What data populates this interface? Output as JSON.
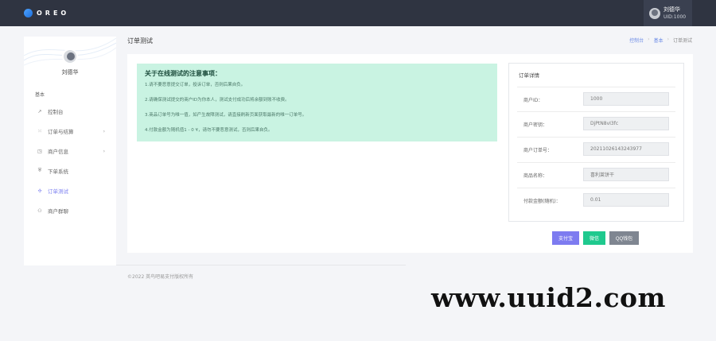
{
  "brand": {
    "logo_text": "OREO"
  },
  "user": {
    "name": "刘德华",
    "uid": "UID:1000"
  },
  "sidebar": {
    "username": "刘德华",
    "section": "基本",
    "items": [
      {
        "label": "控制台",
        "icon": "dashboard-icon"
      },
      {
        "label": "订单与结算",
        "icon": "grid-icon",
        "has_arrow": true
      },
      {
        "label": "商户信息",
        "icon": "store-icon",
        "has_arrow": true
      },
      {
        "label": "下单系统",
        "icon": "shield-icon"
      },
      {
        "label": "订单测试",
        "icon": "test-icon",
        "active": true
      },
      {
        "label": "商户群聊",
        "icon": "users-icon"
      }
    ],
    "arrow_glyph": "›"
  },
  "page": {
    "title": "订单测试",
    "breadcrumb": [
      "控制台",
      "基本",
      "订单测试"
    ],
    "breadcrumb_sep": "›"
  },
  "notice": {
    "title": "关于在线测试的注意事项：",
    "lines": [
      "1.请不要恶意提交订单，投诉订单，否则后果自负。",
      "2.请确保测试提交的商户ID为你本人，测试支付成功后将余额到账不收费。",
      "3.商品订单号为唯一值，如产生故障测试，请直接刷新页面获取最新的唯一订单号。",
      "4.付款金额为随机值1 - 0 ¥，请勿不要恶意测试，否则后果自负。"
    ]
  },
  "detail": {
    "title": "订单详情",
    "fields": [
      {
        "label": "商户ID：",
        "value": "1000"
      },
      {
        "label": "商户密钥：",
        "value": "DjPtN8vI3fc"
      },
      {
        "label": "商户订单号：",
        "value": "20211026143243977"
      },
      {
        "label": "商品名称：",
        "value": "喜利莱饼干"
      },
      {
        "label": "付款金额(随机)：",
        "value": "0.01"
      }
    ]
  },
  "pay_buttons": {
    "alipay": "支付宝",
    "wechat": "微信",
    "qq": "QQ钱包"
  },
  "colors": {
    "topbar": "#2f3441",
    "accent": "#7d7bf0",
    "notice_bg": "#c9f3e2",
    "wechat": "#1fc98e",
    "qq": "#7f8691"
  },
  "footer": "©2022 英鸟吧易支付版权所有",
  "watermark": "www.uuid2.com"
}
